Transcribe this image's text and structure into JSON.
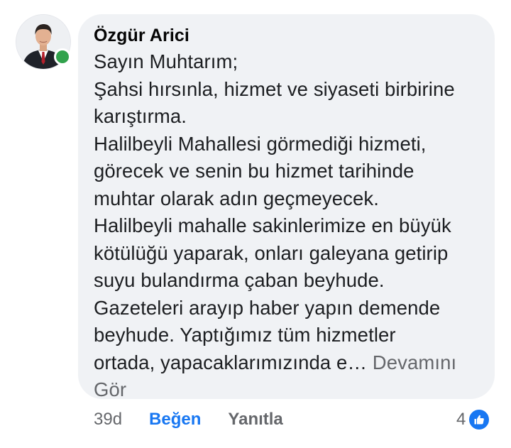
{
  "comment": {
    "author": "Özgür Arici",
    "lines": [
      "Sayın Muhtarım;",
      "Şahsi hırsınla, hizmet ve siyaseti birbirine",
      "karıştırma.",
      "Halilbeyli Mahallesi görmediği hizmeti,",
      "görecek ve senin bu hizmet tarihinde",
      "muhtar olarak adın geçmeyecek.",
      "Halilbeyli mahalle sakinlerimize en büyük",
      "kötülüğü yaparak, onları galeyana getirip",
      "suyu bulandırma çaban beyhude.",
      "Gazeteleri arayıp haber yapın demende",
      "beyhude. Yaptığımız tüm hizmetler"
    ],
    "last_line_text": "ortada, yapacaklarımızında e…",
    "see_more_part1": "Devamını",
    "see_more_part2": "Gör",
    "author_online": true
  },
  "actions": {
    "time": "39d",
    "like_label": "Beğen",
    "reply_label": "Yanıtla"
  },
  "reactions": {
    "count": "4",
    "icon": "thumbs-up-icon"
  },
  "colors": {
    "bubble_bg": "#f0f2f5",
    "link_blue": "#1877f2",
    "secondary_text": "#65676b",
    "online_green": "#31a24c"
  }
}
